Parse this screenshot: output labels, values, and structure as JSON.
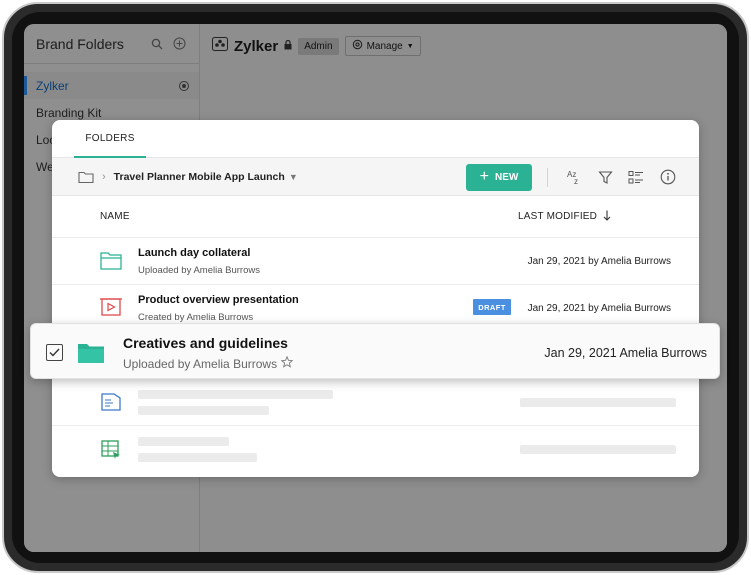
{
  "sidebar": {
    "title": "Brand Folders",
    "items": [
      {
        "label": "Zylker"
      },
      {
        "label": "Branding Kit"
      },
      {
        "label": "Loc"
      },
      {
        "label": "We"
      }
    ]
  },
  "header": {
    "org_title": "Zylker",
    "role_badge": "Admin",
    "manage_label": "Manage"
  },
  "card": {
    "tab_label": "FOLDERS",
    "breadcrumb": "Travel Planner Mobile App Launch",
    "new_button": "NEW",
    "sort_icon_text": "Az",
    "columns": {
      "name": "NAME",
      "last_modified": "LAST MODIFIED"
    },
    "rows": [
      {
        "title": "Launch day collateral",
        "subtitle": "Uploaded by Amelia Burrows",
        "modified": "Jan 29, 2021 by Amelia Burrows",
        "icon": "folder-icon"
      },
      {
        "title": "Product overview presentation",
        "subtitle": "Created by Amelia Burrows",
        "modified": "Jan 29, 2021 by Amelia Burrows",
        "badge": "DRAFT",
        "icon": "presentation-icon"
      }
    ]
  },
  "selected_row": {
    "title": "Creatives and guidelines",
    "subtitle": "Uploaded by Amelia Burrows",
    "modified": "Jan 29, 2021 Amelia Burrows",
    "icon": "folder-icon"
  },
  "colors": {
    "accent": "#2bb295",
    "draft_badge": "#4a8fe0",
    "folder": "#2bb295",
    "presentation": "#e04a4a",
    "doc": "#3a78c9",
    "sheet": "#2e9e5e"
  }
}
